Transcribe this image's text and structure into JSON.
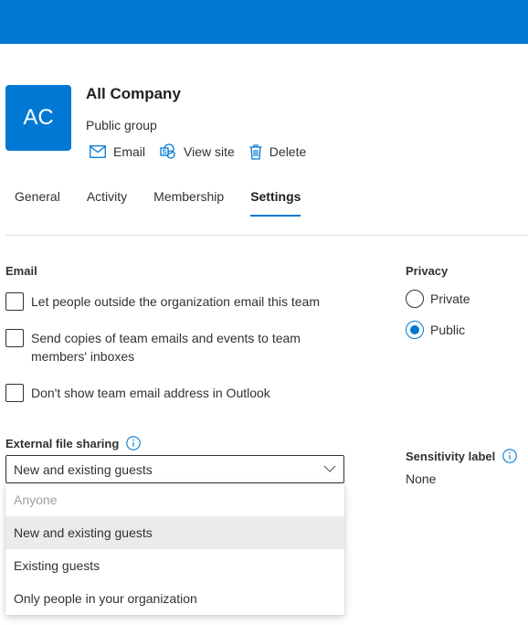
{
  "group": {
    "initials": "AC",
    "name": "All Company",
    "type": "Public group"
  },
  "actions": [
    {
      "label": "Email",
      "icon": "mail-icon"
    },
    {
      "label": "View site",
      "icon": "sharepoint-icon"
    },
    {
      "label": "Delete",
      "icon": "trash-icon"
    }
  ],
  "tabs": [
    {
      "label": "General",
      "active": false
    },
    {
      "label": "Activity",
      "active": false
    },
    {
      "label": "Membership",
      "active": false
    },
    {
      "label": "Settings",
      "active": true
    }
  ],
  "email": {
    "title": "Email",
    "options": [
      {
        "label": "Let people outside the organization email this team",
        "checked": false
      },
      {
        "label": "Send copies of team emails and events to team members' inboxes",
        "checked": false
      },
      {
        "label": "Don't show team email address in Outlook",
        "checked": false
      }
    ]
  },
  "privacy": {
    "title": "Privacy",
    "options": [
      {
        "label": "Private",
        "selected": false
      },
      {
        "label": "Public",
        "selected": true
      }
    ]
  },
  "external_sharing": {
    "title": "External file sharing",
    "selected": "New and existing guests",
    "options": [
      {
        "label": "Anyone",
        "state": "disabled"
      },
      {
        "label": "New and existing guests",
        "state": "selected"
      },
      {
        "label": "Existing guests",
        "state": "normal"
      },
      {
        "label": "Only people in your organization",
        "state": "normal"
      }
    ]
  },
  "sensitivity": {
    "title": "Sensitivity label",
    "value": "None"
  },
  "colors": {
    "accent": "#0078d4",
    "text": "#323130",
    "menu_hover": "#edebe9"
  }
}
